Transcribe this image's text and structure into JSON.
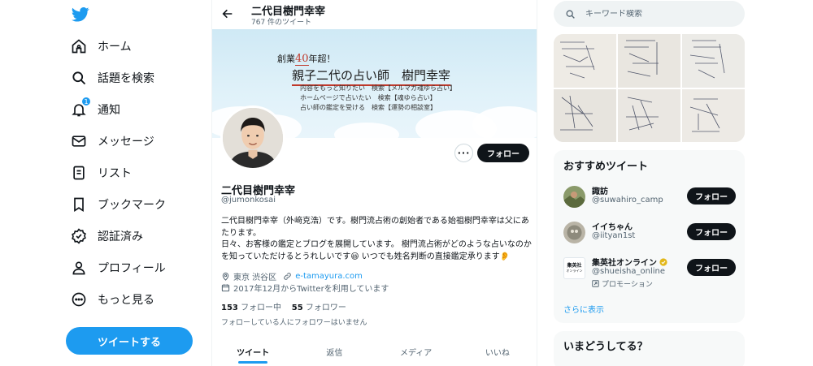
{
  "colors": {
    "accent": "#1d9bf0",
    "text": "#0f1419",
    "muted": "#536471",
    "banner_red": "#c0392b"
  },
  "nav": {
    "items": [
      {
        "label": "ホーム",
        "icon": "home-icon"
      },
      {
        "label": "話題を検索",
        "icon": "search-icon"
      },
      {
        "label": "通知",
        "icon": "bell-icon",
        "badge": "1"
      },
      {
        "label": "メッセージ",
        "icon": "mail-icon"
      },
      {
        "label": "リスト",
        "icon": "list-icon"
      },
      {
        "label": "ブックマーク",
        "icon": "bookmark-icon"
      },
      {
        "label": "認証済み",
        "icon": "verified-icon"
      },
      {
        "label": "プロフィール",
        "icon": "person-icon"
      },
      {
        "label": "もっと見る",
        "icon": "more-circle-icon"
      }
    ],
    "tweet_button": "ツイートする"
  },
  "header": {
    "title": "二代目樹門幸宰",
    "subtitle": "767 件のツイート"
  },
  "banner": {
    "line1_prefix": "創業",
    "line1_num": "40",
    "line1_suffix": "年超！",
    "line2": "親子二代の占い師　樹門幸宰",
    "lines": [
      "内容をもっと知りたい　検索【メルマガ魂ゆら占い】",
      "ホームページで占いたい　検索【魂ゆら占い】",
      "占い師の鑑定を受ける　検索【運勢の相談室】"
    ]
  },
  "profile": {
    "more_label": "···",
    "follow_label": "フォロー",
    "name": "二代目樹門幸宰",
    "handle": "@jumonkosai",
    "bio": "二代目樹門幸宰（外﨑克浩）です。樹門流占術の創始者である始祖樹門幸宰は父にあたります。\n日々、お客様の鑑定とブログを展開しています。 樹門流占術がどのような占いなのかを知っていただけるとうれしいです😃  いつでも姓名判断の直接鑑定承ります👂",
    "location": "東京 渋谷区",
    "url": "e-tamayura.com",
    "joined": "2017年12月からTwitterを利用しています",
    "following_count": "153",
    "following_label": "フォロー中",
    "followers_count": "55",
    "followers_label": "フォロワー",
    "followed_by_note": "フォローしている人にフォロワーはいません"
  },
  "tabs": [
    {
      "label": "ツイート",
      "active": true
    },
    {
      "label": "返信",
      "active": false
    },
    {
      "label": "メディア",
      "active": false
    },
    {
      "label": "いいね",
      "active": false
    }
  ],
  "search": {
    "placeholder": "キーワード検索"
  },
  "recommend": {
    "title": "おすすめツイート",
    "users": [
      {
        "name": "諏訪",
        "handle": "@suwahiro_camp",
        "follow": "フォロー"
      },
      {
        "name": "イイちゃん",
        "handle": "@iityan1st",
        "follow": "フォロー"
      },
      {
        "name": "集英社オンライン",
        "handle": "@shueisha_online",
        "follow": "フォロー",
        "promo": "プロモーション",
        "avatar_text_1": "集英社",
        "avatar_text_2": "オンライン"
      }
    ],
    "show_more": "さらに表示"
  },
  "trends": {
    "title": "いまどうしてる？"
  }
}
